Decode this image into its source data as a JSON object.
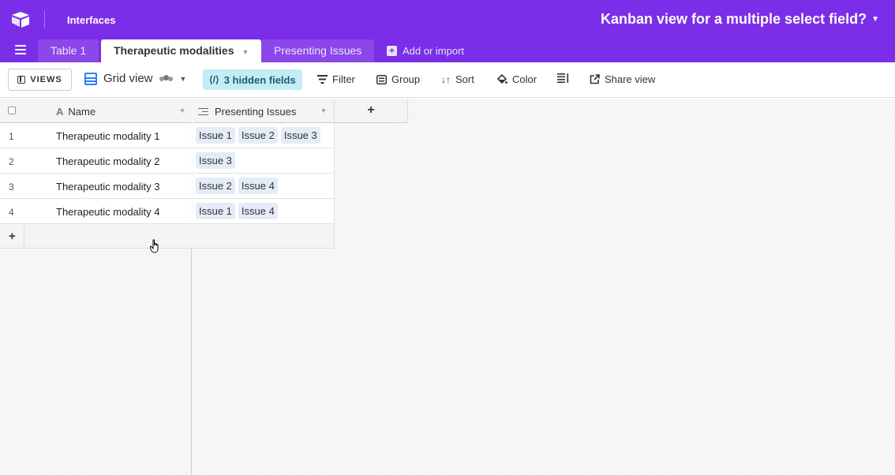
{
  "topbar": {
    "interfaces_label": "Interfaces",
    "base_title": "Kanban view for a multiple select field?",
    "accent_color": "#7b2ee8"
  },
  "tabs": [
    {
      "label": "Table 1",
      "active": false
    },
    {
      "label": "Therapeutic modalities",
      "active": true
    },
    {
      "label": "Presenting Issues",
      "active": false
    }
  ],
  "add_import_label": "Add or import",
  "toolbar": {
    "views_label": "VIEWS",
    "view_name": "Grid view",
    "hidden_fields": "3 hidden fields",
    "filter": "Filter",
    "group": "Group",
    "sort": "Sort",
    "color": "Color",
    "share_view": "Share view"
  },
  "table": {
    "columns": [
      "Name",
      "Presenting Issues"
    ],
    "rows": [
      {
        "num": "1",
        "name": "Therapeutic modality 1",
        "issues": [
          "Issue 1",
          "Issue 2",
          "Issue 3"
        ]
      },
      {
        "num": "2",
        "name": "Therapeutic modality 2",
        "issues": [
          "Issue 3"
        ]
      },
      {
        "num": "3",
        "name": "Therapeutic modality 3",
        "issues": [
          "Issue 2",
          "Issue 4"
        ]
      },
      {
        "num": "4",
        "name": "Therapeutic modality 4",
        "issues": [
          "Issue 1",
          "Issue 4"
        ]
      }
    ],
    "add_field_symbol": "+",
    "add_row_symbol": "+"
  }
}
